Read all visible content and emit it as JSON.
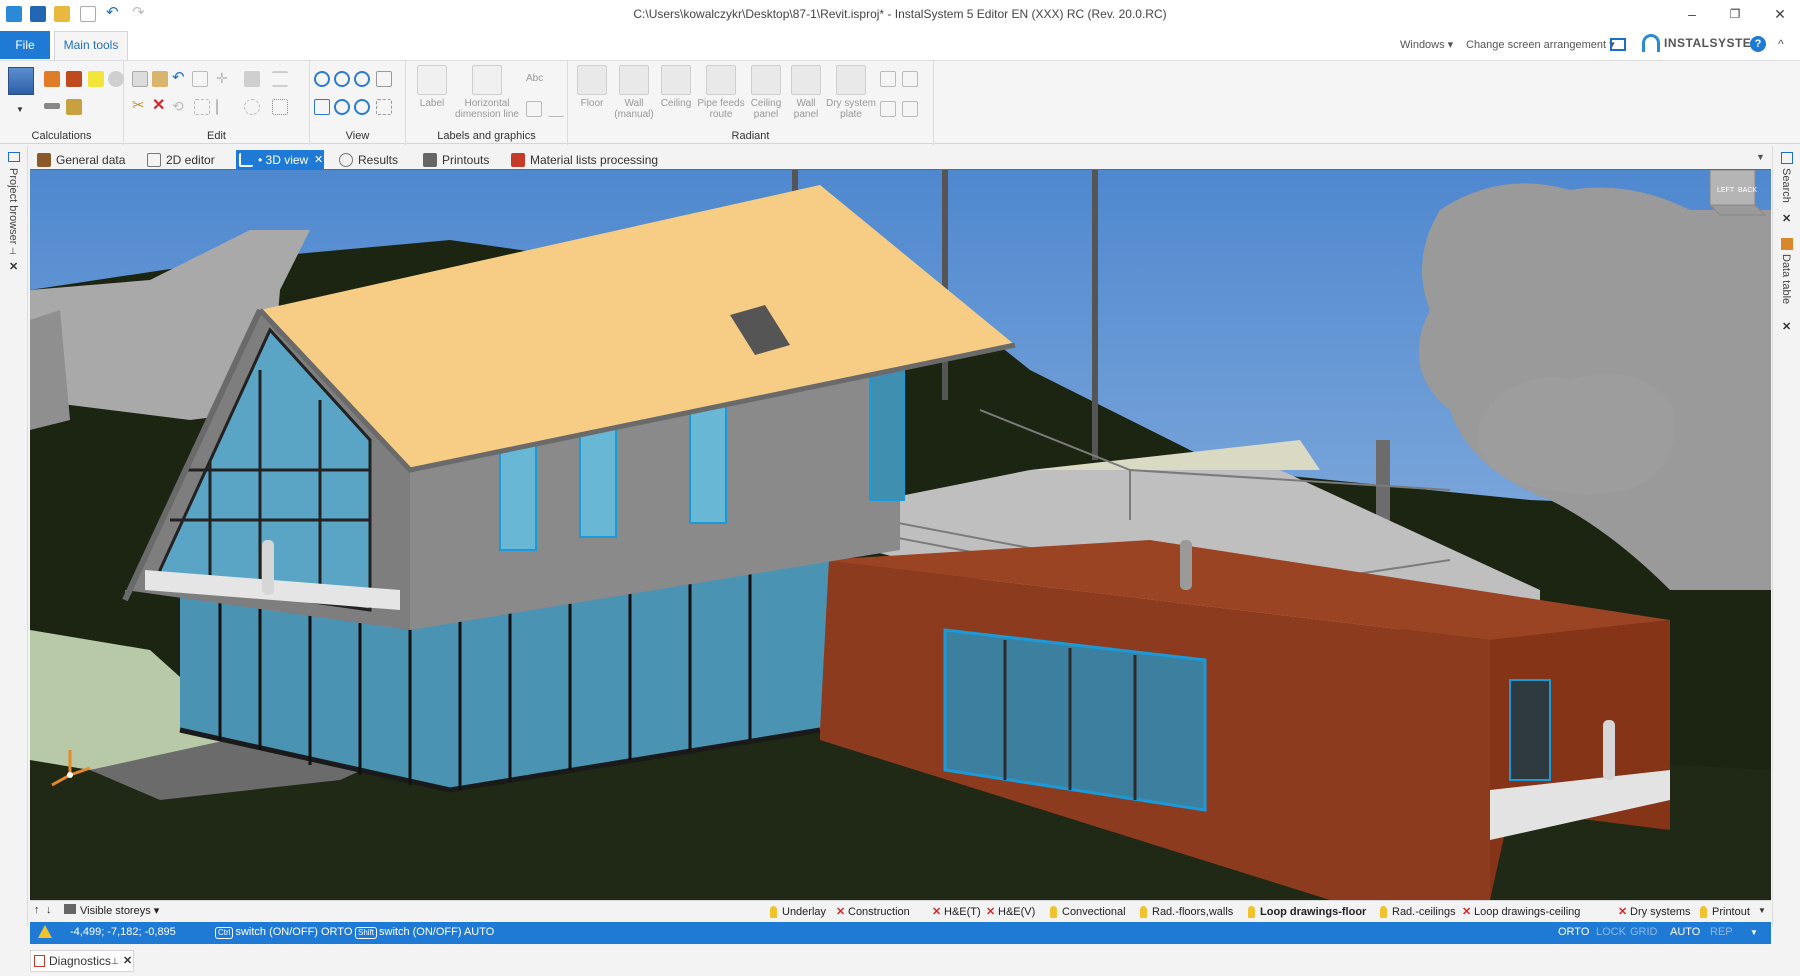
{
  "window": {
    "title": "C:\\Users\\kowalczykr\\Desktop\\87-1\\Revit.isproj* - InstalSystem 5 Editor EN (XXX) RC (Rev. 20.0.RC)",
    "minimize": "–",
    "restore": "❐",
    "close": "✕"
  },
  "ribbon_tabs": {
    "file": "File",
    "main_tools": "Main tools",
    "windows": "Windows ▾",
    "change_screen": "Change screen arrangement ▾",
    "brand": "INSTALSYSTEM",
    "help": "?",
    "collapse": "^"
  },
  "ribbon": {
    "groups": {
      "calculations": "Calculations",
      "edit": "Edit",
      "view": "View",
      "labels_graphics": "Labels and graphics",
      "radiant": "Radiant"
    },
    "buttons": {
      "label": "Label",
      "horizontal_dimension_line": "Horizontal dimension line",
      "abc": "Abc",
      "floor": "Floor",
      "wall_manual": "Wall (manual)",
      "ceiling": "Ceiling",
      "pipe_feeds_route": "Pipe feeds route",
      "ceiling_panel": "Ceiling panel",
      "wall_panel": "Wall panel",
      "dry_system_plate": "Dry system plate"
    }
  },
  "doc_tabs": [
    {
      "label": "General data"
    },
    {
      "label": "2D editor"
    },
    {
      "label": "• 3D view"
    },
    {
      "label": "Results"
    },
    {
      "label": "Printouts"
    },
    {
      "label": "Material lists processing"
    }
  ],
  "side_panels": {
    "project_browser": "Project browser",
    "search": "Search",
    "data_table": "Data table"
  },
  "viewcube": {
    "left": "LEFT",
    "back": "BACK"
  },
  "layerbar": {
    "visible_storeys": "Visible storeys",
    "layers": [
      {
        "label": "Underlay",
        "icon": "bulb-icon"
      },
      {
        "label": "Construction",
        "icon": "cross-icon"
      },
      {
        "label": "H&E(T)",
        "icon": "cross-icon"
      },
      {
        "label": "H&E(V)",
        "icon": "cross-icon"
      },
      {
        "label": "Convectional",
        "icon": "bulb-icon"
      },
      {
        "label": "Rad.-floors,walls",
        "icon": "bulb-icon"
      },
      {
        "label": "Loop drawings-floor",
        "icon": "bulb-icon"
      },
      {
        "label": "Rad.-ceilings",
        "icon": "bulb-icon"
      },
      {
        "label": "Loop drawings-ceiling",
        "icon": "cross-icon"
      },
      {
        "label": "Dry systems",
        "icon": "cross-icon"
      },
      {
        "label": "Printout",
        "icon": "bulb-icon"
      }
    ]
  },
  "statusbar": {
    "coords": "-4,499; -7,182; -0,895",
    "ctrl_key": "Ctrl",
    "ctrl_text": "switch (ON/OFF) ORTO",
    "shift_key": "Shift",
    "shift_text": "switch (ON/OFF) AUTO",
    "modes": [
      "ORTO",
      "LOCK",
      "GRID",
      "AUTO",
      "REP"
    ]
  },
  "diagnostics": {
    "label": "Diagnostics"
  },
  "colors": {
    "accent": "#1e7ad4",
    "roof": "#f7cd85",
    "wall_grey": "#8a8a8a",
    "wood": "#8d3b1e",
    "sky": "#5a90cf",
    "grass": "#1c2512"
  }
}
